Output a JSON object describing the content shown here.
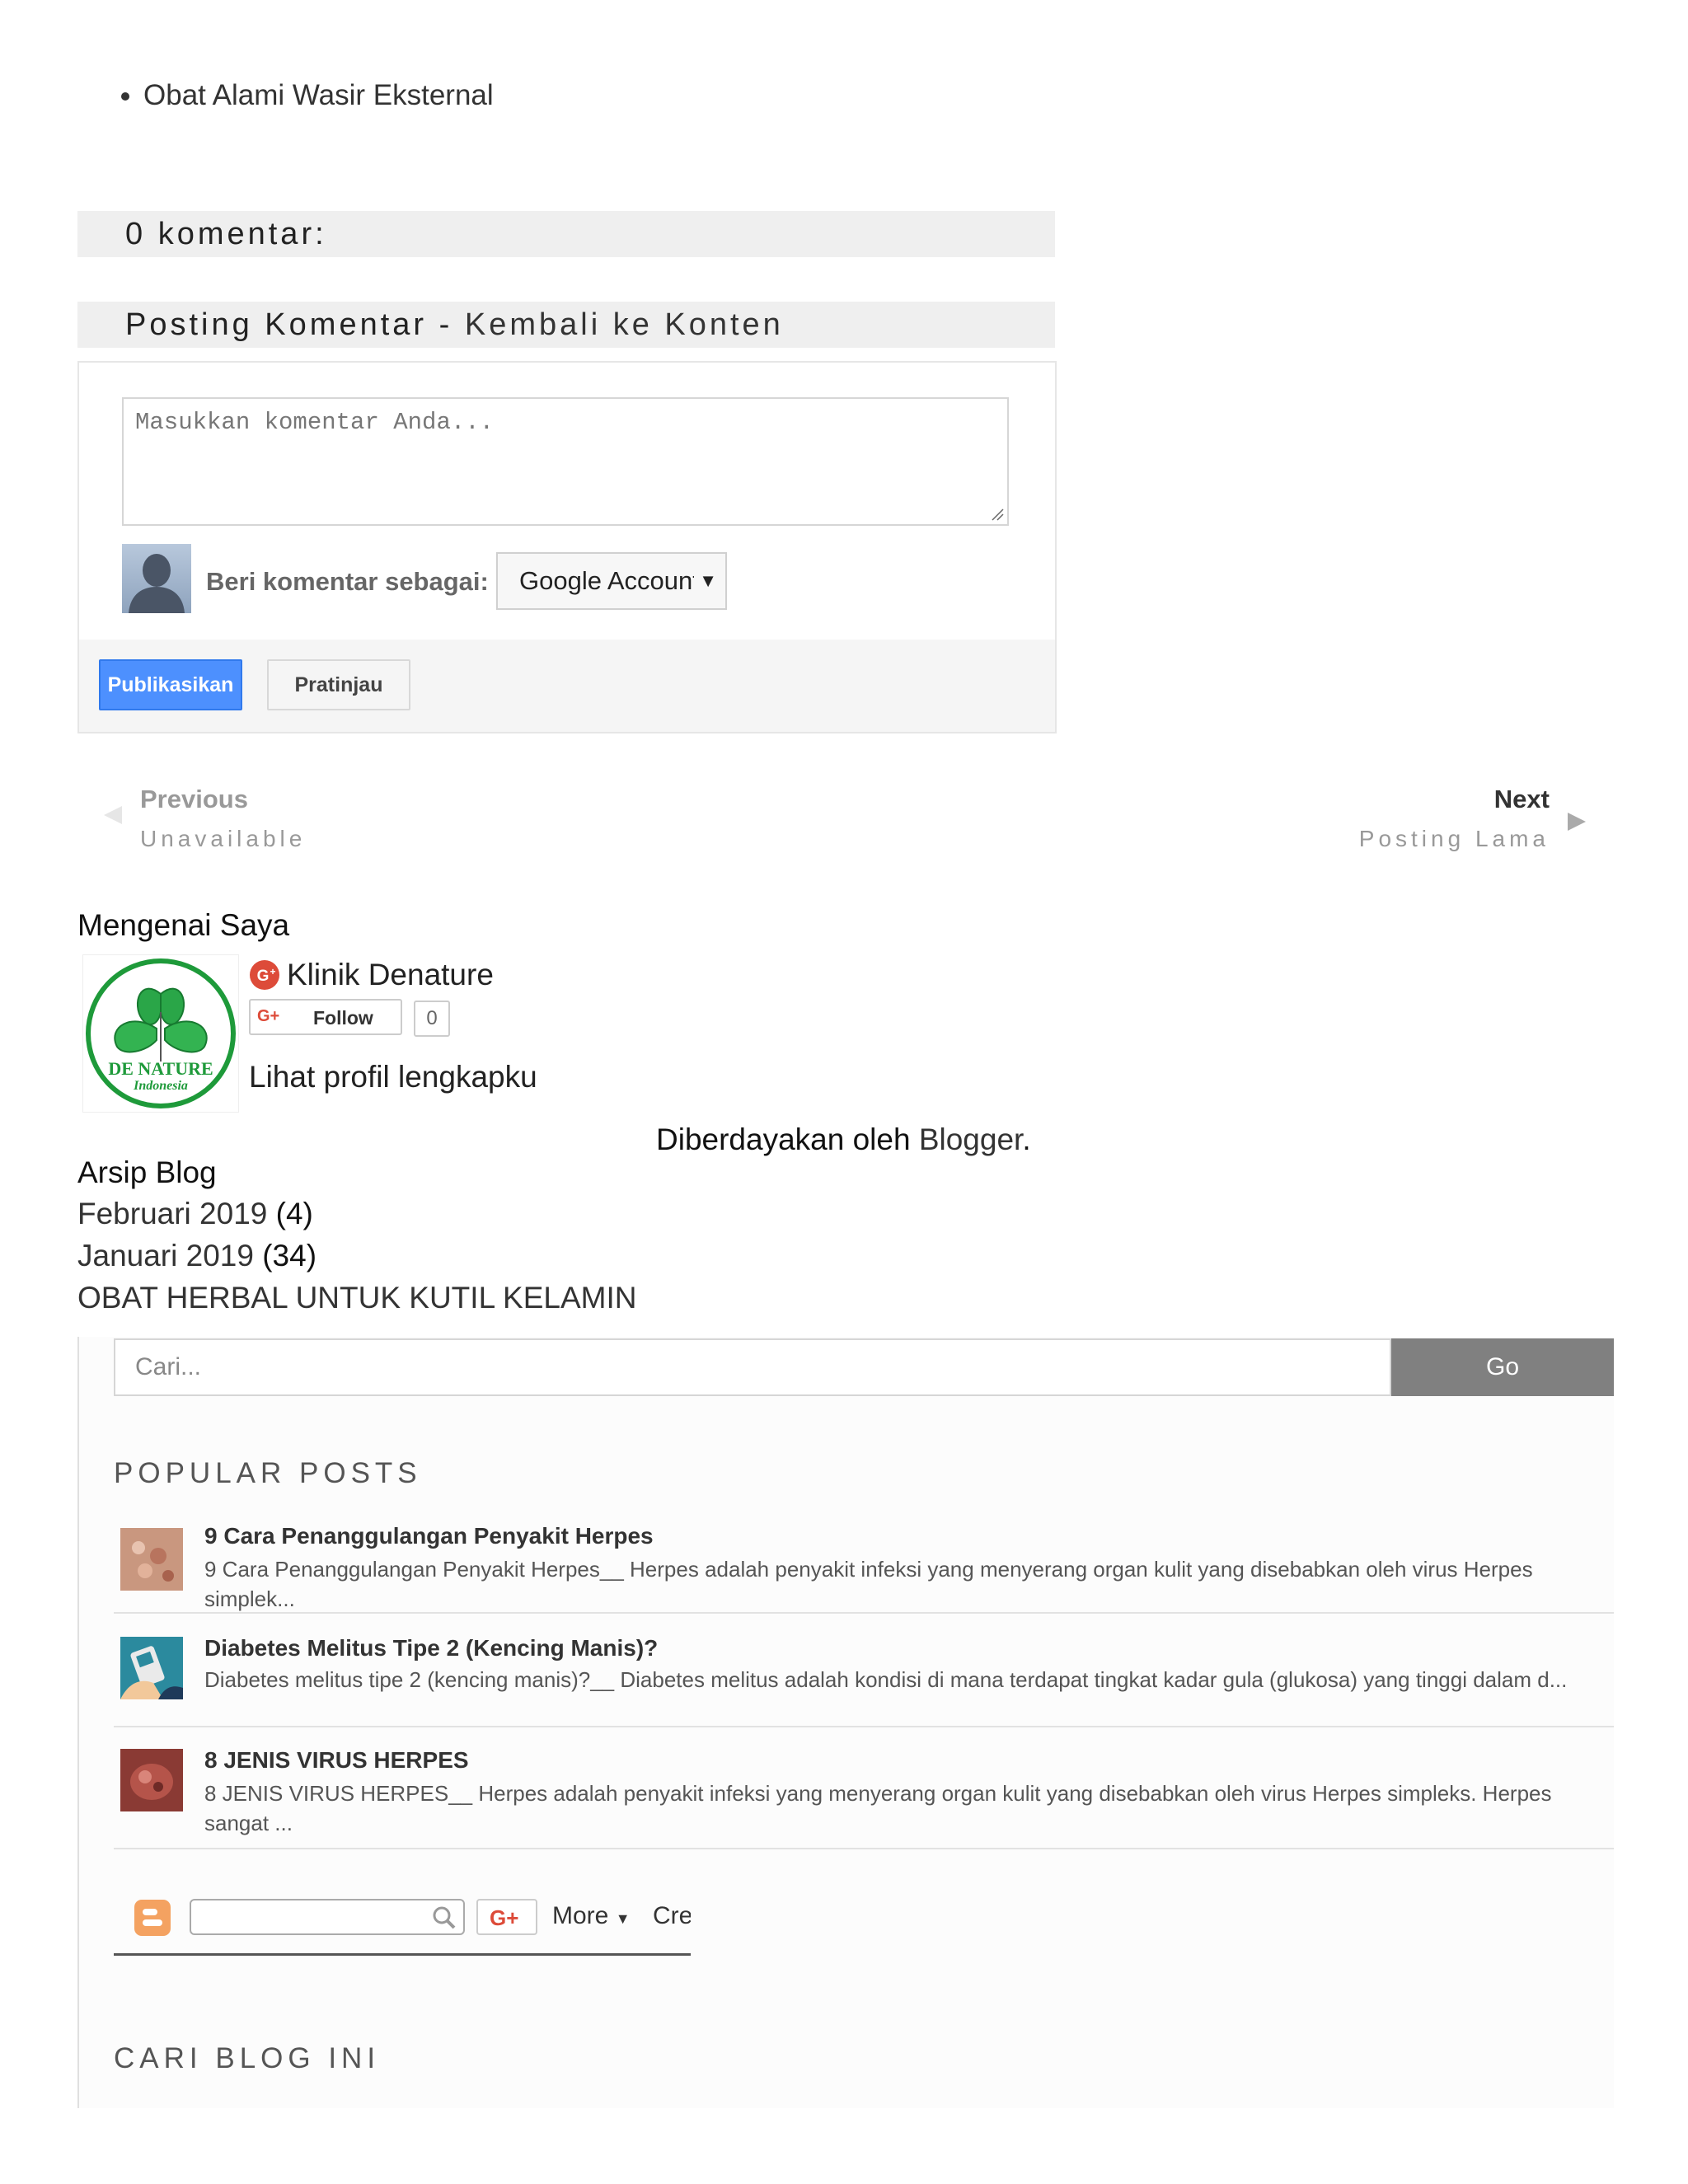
{
  "post_list": [
    "Obat Alami Wasir Eksternal"
  ],
  "comments": {
    "count_heading": "0 komentar:",
    "post_comment_heading": "Posting Komentar",
    "separator": " - ",
    "back_link": "Kembali ke Konten",
    "textarea_placeholder": "Masukkan komentar Anda...",
    "comment_as_label": "Beri komentar sebagai:",
    "account_selected": "Google Account",
    "publish_button": "Publikasikan",
    "preview_button": "Pratinjau"
  },
  "pager": {
    "previous_label": "Previous",
    "previous_sub": "Unavailable",
    "next_label": "Next",
    "next_sub": "Posting Lama"
  },
  "profile": {
    "heading": "Mengenai Saya",
    "name": "Klinik Denature",
    "follow_label": "Follow",
    "follower_count": "0",
    "view_profile_link": "Lihat profil lengkapku",
    "logo_text_top": "DE NATURE",
    "logo_text_bottom": "Indonesia"
  },
  "powered_by": {
    "prefix": "Diberdayakan oleh ",
    "link": "Blogger",
    "suffix": "."
  },
  "archive": {
    "heading": "Arsip Blog",
    "items": [
      {
        "month": "Februari 2019",
        "count": "(4)"
      },
      {
        "month": "Januari 2019",
        "count": "(34)"
      }
    ],
    "banner_title": "OBAT HERBAL UNTUK KUTIL KELAMIN"
  },
  "sidebar": {
    "search_placeholder": "Cari...",
    "search_button": "Go",
    "popular_heading": "POPULAR POSTS",
    "popular_posts": [
      {
        "title": "9 Cara Penanggulangan Penyakit Herpes",
        "snippet": "9 Cara Penanggulangan Penyakit Herpes__ Herpes adalah penyakit infeksi yang menyerang organ kulit yang disebabkan oleh virus Herpes simplek..."
      },
      {
        "title": "Diabetes Melitus Tipe 2 (Kencing Manis)?",
        "snippet": "Diabetes melitus tipe 2 (kencing manis)?__ Diabetes melitus adalah kondisi di mana terdapat tingkat kadar gula (glukosa) yang tinggi dalam d..."
      },
      {
        "title": "8 JENIS VIRUS HERPES",
        "snippet": "8 JENIS VIRUS HERPES__ Herpes adalah penyakit infeksi yang menyerang organ kulit yang disebabkan oleh virus Herpes simpleks. Herpes sangat ..."
      }
    ],
    "navbar_more": "More",
    "navbar_create": "Cre",
    "search_blog_heading": "CARI BLOG INI"
  },
  "colors": {
    "publish_blue": "#4d90fe",
    "go_gray": "#808080",
    "gplus_red": "#dd4b39",
    "blogger_orange": "#f4a261",
    "logo_green": "#1e9a3a"
  }
}
